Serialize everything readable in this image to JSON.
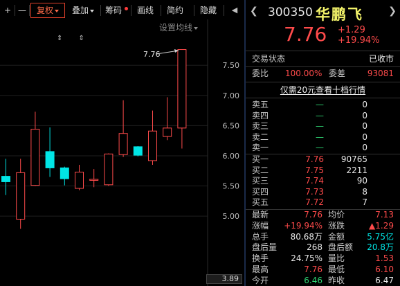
{
  "toolbar": {
    "plus": "+",
    "minus": "—",
    "fq": "复权",
    "overlay": "叠加",
    "chips": "筹码",
    "draw": "画线",
    "simple": "简约",
    "hide": "隐藏",
    "more": "◀"
  },
  "chart": {
    "settings_label": "设置均线",
    "arrows": "⇕ ⇕",
    "max_label": "7.76",
    "y_bottom_value": "3.89"
  },
  "chart_data": {
    "type": "candlestick",
    "y_ticks": [
      "7.50",
      "7.00",
      "6.50",
      "6.00",
      "5.50",
      "5.00"
    ],
    "ylim": [
      4.6,
      7.95
    ],
    "candles": [
      {
        "o": 5.57,
        "c": 5.66,
        "h": 5.95,
        "l": 5.35,
        "up": false
      },
      {
        "o": 4.95,
        "c": 5.72,
        "h": 5.95,
        "l": 4.79,
        "up": true
      },
      {
        "o": 5.51,
        "c": 6.44,
        "h": 6.73,
        "l": 5.5,
        "up": true
      },
      {
        "o": 6.07,
        "c": 5.8,
        "h": 6.47,
        "l": 5.65,
        "up": false
      },
      {
        "o": 5.8,
        "c": 5.62,
        "h": 5.82,
        "l": 5.51,
        "up": false
      },
      {
        "o": 5.46,
        "c": 5.73,
        "h": 5.85,
        "l": 5.43,
        "up": true
      },
      {
        "o": 5.61,
        "c": 5.6,
        "h": 5.78,
        "l": 5.48,
        "up": true
      },
      {
        "o": 5.52,
        "c": 6.03,
        "h": 6.04,
        "l": 5.5,
        "up": true
      },
      {
        "o": 6.02,
        "c": 6.37,
        "h": 6.92,
        "l": 5.98,
        "up": true
      },
      {
        "o": 6.15,
        "c": 6.01,
        "h": 6.16,
        "l": 5.99,
        "up": false
      },
      {
        "o": 5.92,
        "c": 6.41,
        "h": 6.75,
        "l": 5.85,
        "up": true
      },
      {
        "o": 6.32,
        "c": 6.46,
        "h": 6.97,
        "l": 6.26,
        "up": true
      },
      {
        "o": 6.46,
        "c": 7.76,
        "h": 7.76,
        "l": 6.12,
        "up": true
      }
    ]
  },
  "quote": {
    "code": "300350",
    "name": "华鹏飞",
    "price": "7.76",
    "change": "+1.29",
    "change_pct": "+19.94%",
    "status_label": "交易状态",
    "status_value": "已收市",
    "weibi_label": "委比",
    "weibi_value": "100.00%",
    "weicha_label": "委差",
    "weicha_value": "93081",
    "link_text": "仅需20元查看十档行情",
    "asks": [
      {
        "label": "卖五",
        "price": "—",
        "vol": "0"
      },
      {
        "label": "卖四",
        "price": "—",
        "vol": "0"
      },
      {
        "label": "卖三",
        "price": "—",
        "vol": "0"
      },
      {
        "label": "卖二",
        "price": "—",
        "vol": "0"
      },
      {
        "label": "卖一",
        "price": "—",
        "vol": "0"
      }
    ],
    "bids": [
      {
        "label": "买一",
        "price": "7.76",
        "vol": "90765"
      },
      {
        "label": "买二",
        "price": "7.75",
        "vol": "2211"
      },
      {
        "label": "买三",
        "price": "7.74",
        "vol": "90"
      },
      {
        "label": "买四",
        "price": "7.73",
        "vol": "8"
      },
      {
        "label": "买五",
        "price": "7.72",
        "vol": "7"
      }
    ],
    "stats": [
      {
        "l1": "最新",
        "v1": "7.76",
        "c1": "red",
        "l2": "均价",
        "v2": "7.13",
        "c2": "red"
      },
      {
        "l1": "涨幅",
        "v1": "+19.94%",
        "c1": "red",
        "l2": "涨跌",
        "v2": "▲1.29",
        "c2": "red"
      },
      {
        "l1": "总手",
        "v1": "80.68万",
        "c1": "wht",
        "l2": "金额",
        "v2": "5.75亿",
        "c2": "cyn"
      },
      {
        "l1": "盘后量",
        "v1": "268",
        "c1": "wht",
        "l2": "盘后额",
        "v2": "20.8万",
        "c2": "cyn"
      },
      {
        "l1": "换手",
        "v1": "24.75%",
        "c1": "wht",
        "l2": "量比",
        "v2": "1.53",
        "c2": "red"
      },
      {
        "l1": "最高",
        "v1": "7.76",
        "c1": "red",
        "l2": "最低",
        "v2": "6.10",
        "c2": "red"
      },
      {
        "l1": "今开",
        "v1": "6.46",
        "c1": "grn",
        "l2": "昨收",
        "v2": "6.47",
        "c2": "wht"
      }
    ]
  },
  "colors": {
    "up": "#ff4b4b",
    "down": "#00e5e5",
    "background": "#000000"
  }
}
